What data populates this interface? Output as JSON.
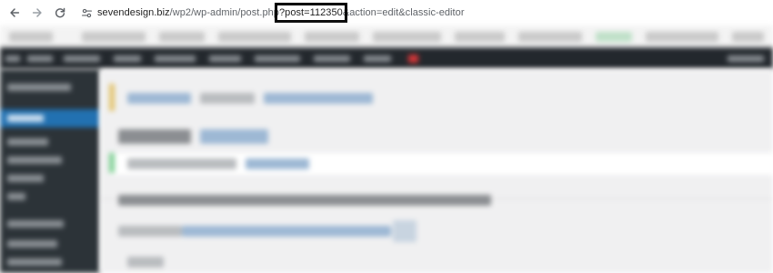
{
  "browser": {
    "url_host": "sevendesign.biz",
    "url_path": "/wp2/wp-admin/post.php",
    "url_highlight": "?post=112350",
    "url_rest": "&action=edit&classic-editor",
    "nav_icons": [
      "back-arrow-icon",
      "forward-arrow-icon",
      "reload-icon",
      "site-info-icon"
    ]
  },
  "colors": {
    "admin_bar": "#23282d",
    "admin_menu": "#2c3338",
    "admin_menu_active": "#2271b1",
    "content_bg": "#f0f0f1",
    "highlight_box": "#000000"
  }
}
